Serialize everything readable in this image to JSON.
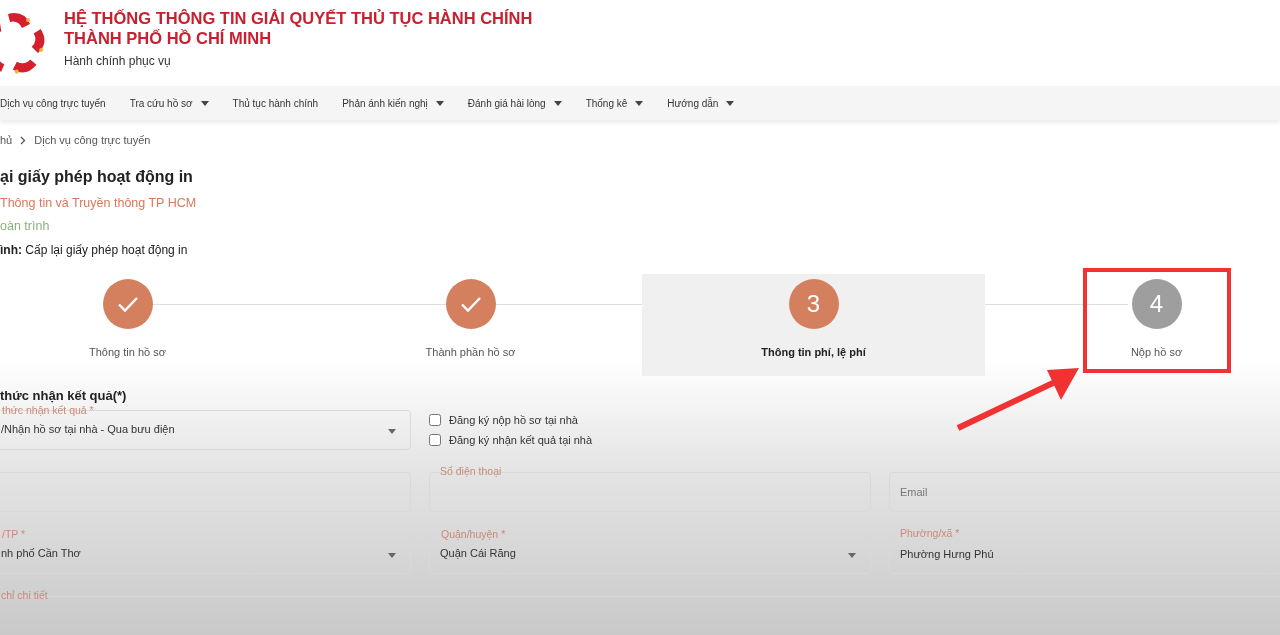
{
  "header": {
    "title_lines": [
      "HỆ THỐNG THÔNG TIN GIẢI QUYẾT THỦ TỤC HÀNH CHÍNH",
      "THÀNH PHỐ HỒ CHÍ MINH"
    ],
    "subtitle": "Hành chính phục vụ"
  },
  "nav": [
    {
      "label": "Dịch vụ công trực tuyến",
      "dropdown": false
    },
    {
      "label": "Tra cứu hồ sơ",
      "dropdown": true
    },
    {
      "label": "Thủ tục hành chính",
      "dropdown": false
    },
    {
      "label": "Phản ánh kiến nghị",
      "dropdown": true
    },
    {
      "label": "Đánh giá hài lòng",
      "dropdown": true
    },
    {
      "label": "Thống kê",
      "dropdown": true
    },
    {
      "label": "Hướng dẫn",
      "dropdown": true
    }
  ],
  "breadcrumb": [
    "hủ",
    "Dịch vụ công trực tuyến"
  ],
  "procedure": {
    "title": "ại giấy phép hoạt động in",
    "agency": "Thông tin và Truyền thông TP HCM",
    "level": "oàn trình",
    "name": "**ình:** Cấp lại giấy phép hoạt động in"
  },
  "steps": [
    {
      "label": "Thông tin hồ sơ",
      "kind": "done",
      "selected": false,
      "highlighted": false
    },
    {
      "label": "Thành phần hồ sơ",
      "kind": "done",
      "selected": false,
      "highlighted": false
    },
    {
      "label": "Thông tin phí, lệ phí",
      "kind": "current",
      "number": "3",
      "selected": true,
      "highlighted": false
    },
    {
      "label": "Nộp hồ sơ",
      "kind": "pending",
      "number": "4",
      "selected": false,
      "highlighted": true
    }
  ],
  "form": {
    "heading": "thức nhận kết quả(*)",
    "rows": [
      [
        {
          "kind": "select",
          "label": "thức nhận kết quả *",
          "value": "/Nhận hồ sơ tại nhà - Qua bưu điện"
        },
        {
          "kind": "checkboxes",
          "items": [
            {
              "label": "Đăng ký nộp hồ sơ tại nhà",
              "checked": false
            },
            {
              "label": "Đăng ký nhận kết quả tại nhà",
              "checked": false
            }
          ]
        }
      ],
      [
        {
          "kind": "input"
        },
        {
          "kind": "input",
          "label": "Số điện thoại"
        },
        {
          "kind": "input",
          "placeholder": "Email"
        }
      ],
      [
        {
          "kind": "select",
          "label": "/TP *",
          "value": "nh phố Cần Thơ"
        },
        {
          "kind": "select",
          "label": "Quận/huyện *",
          "value": "Quận Cái Răng"
        },
        {
          "kind": "input",
          "label": "Phường/xã *",
          "value": "Phường Hưng Phú"
        }
      ],
      [
        {
          "kind": "input",
          "label": "chỉ chi tiết",
          "wide": true
        }
      ]
    ]
  }
}
